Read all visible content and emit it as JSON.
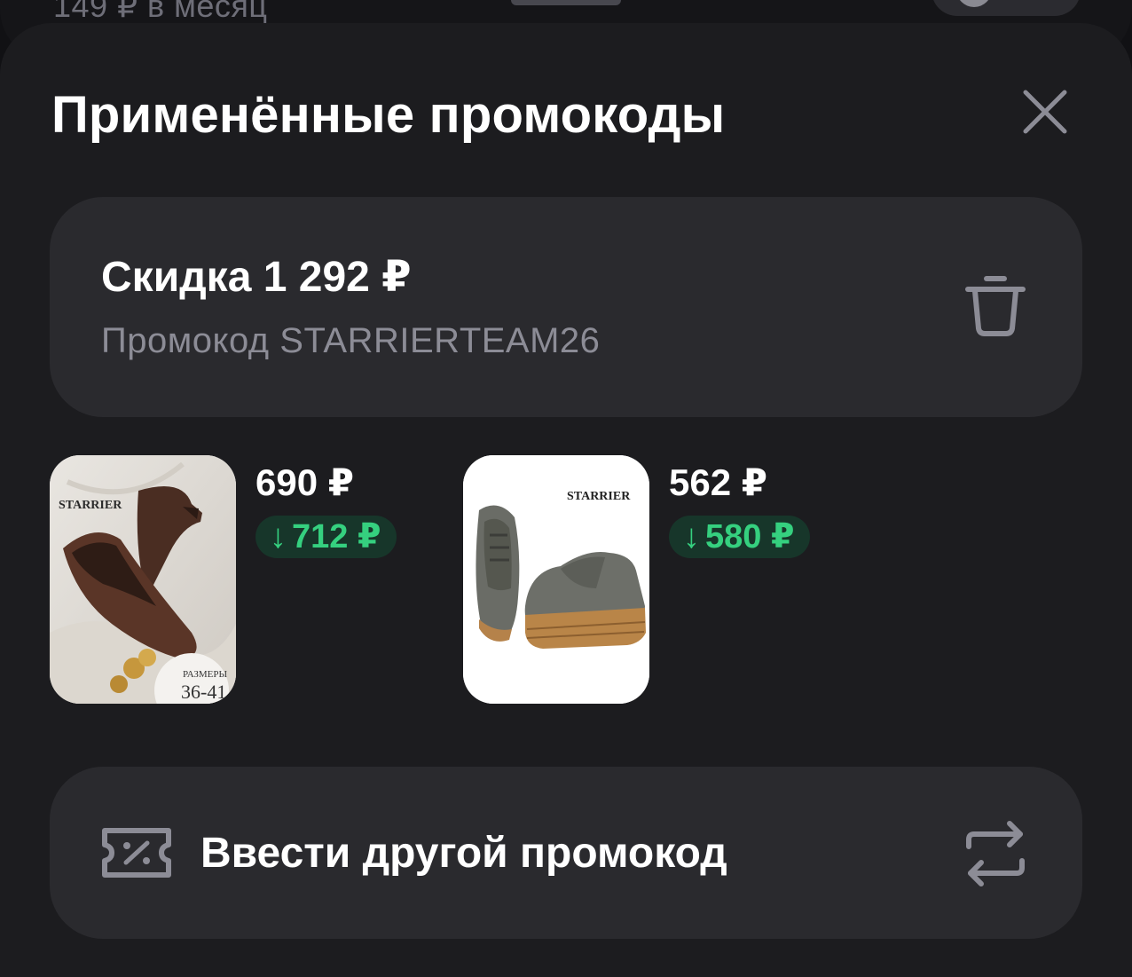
{
  "background": {
    "subscription_text": "149 ₽ в месяц"
  },
  "sheet": {
    "title": "Применённые промокоды",
    "close_icon": "close-icon"
  },
  "promo": {
    "discount": "Скидка 1 292 ₽",
    "code": "Промокод STARRIERTEAM26",
    "delete_icon": "trash-icon"
  },
  "products": [
    {
      "price": "690 ₽",
      "old_price": "712 ₽",
      "arrow": "↓",
      "brand": "STARRIER",
      "sizes_label": "РАЗМЕРЫ",
      "sizes": "36-41"
    },
    {
      "price": "562 ₽",
      "old_price": "580 ₽",
      "arrow": "↓",
      "brand": "STARRIER"
    }
  ],
  "enter_promo": {
    "label": "Ввести другой промокод",
    "left_icon": "ticket-percent-icon",
    "right_icon": "swap-arrows-icon"
  },
  "colors": {
    "sheet_bg": "#1c1c1f",
    "card_bg": "#2a2a2e",
    "accent_green": "#35d07f",
    "pill_bg": "#17362a",
    "muted_text": "#8c8c96"
  }
}
